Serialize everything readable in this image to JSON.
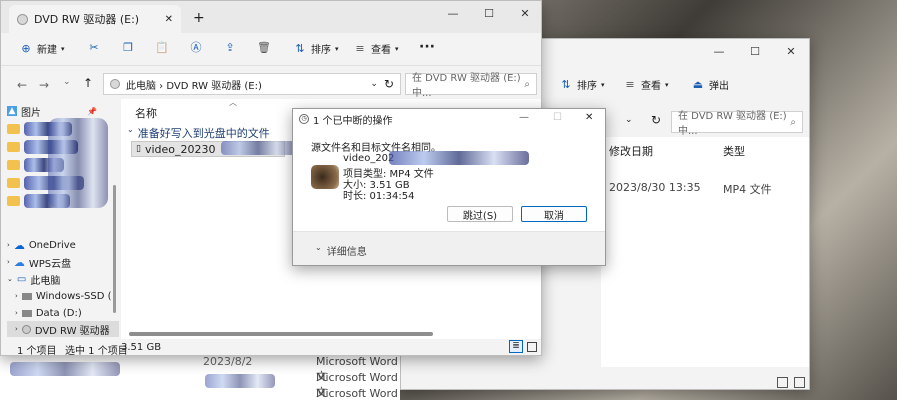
{
  "main_window": {
    "tab_title": "DVD RW 驱动器 (E:)",
    "toolbar": {
      "new": "新建",
      "sort": "排序",
      "view": "查看",
      "more": "···"
    },
    "address": "此电脑 › DVD RW 驱动器 (E:)",
    "search_placeholder": "在 DVD RW 驱动器 (E:) 中...",
    "column_name": "名称",
    "group_header": "准备好写入到光盘中的文件",
    "file_name": "video_20230",
    "nav": {
      "pictures": "图片",
      "onedrive": "OneDrive",
      "wps": "WPS云盘",
      "this_pc": "此电脑",
      "windows_ssd": "Windows-SSD (",
      "data_d": "Data (D:)",
      "dvd_rw": "DVD RW 驱动器"
    },
    "status": {
      "count": "1 个项目",
      "selected": "选中 1 个项目",
      "size": "3.51 GB"
    }
  },
  "back_window": {
    "toolbar": {
      "sort": "排序",
      "view": "查看",
      "eject": "弹出"
    },
    "search_placeholder": "在 DVD RW 驱动器 (E:) 中...",
    "col_modified": "修改日期",
    "col_type": "类型",
    "row_date": "2023/8/30 13:35",
    "row_type": "MP4 文件"
  },
  "bottom_rows": {
    "date_partial": "2023/8/2",
    "items": [
      "Microsoft Word 文",
      "Microsoft Word 文",
      "Microsoft Word 文"
    ]
  },
  "dialog": {
    "title": "1 个已中断的操作",
    "message": "源文件名和目标文件名相同。",
    "file_name": "video_202",
    "file_type": "项目类型: MP4 文件",
    "file_size": "大小: 3.51 GB",
    "duration": "时长: 01:34:54",
    "skip": "跳过(S)",
    "cancel": "取消",
    "details": "详细信息"
  }
}
